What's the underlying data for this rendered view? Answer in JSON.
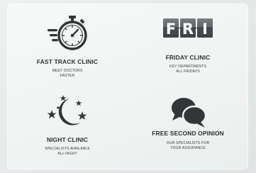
{
  "items": [
    {
      "icon": "stopwatch-icon",
      "title": "FAST TRACK CLINIC",
      "sub1": "MEET DOCTORS",
      "sub2": "FASTER"
    },
    {
      "icon": "calendar-fri-icon",
      "title": "FRIDAY CLINIC",
      "sub1": "KEY DEPARTMENTS",
      "sub2": "ALL FRIDAYS",
      "badge": [
        "F",
        "R",
        "I"
      ]
    },
    {
      "icon": "moon-stars-icon",
      "title": "NIGHT CLINIC",
      "sub1": "SPECIALISTS AVAILABLE",
      "sub2": "ALL NIGHT"
    },
    {
      "icon": "chat-bubbles-icon",
      "title": "FREE SECOND OPINION",
      "sub1": "OUR SPECIALISTS FOR",
      "sub2": "YOUR ASSURANCE"
    }
  ],
  "colors": {
    "icon": "#333638",
    "title": "#2f3133",
    "text": "#3e4042"
  }
}
